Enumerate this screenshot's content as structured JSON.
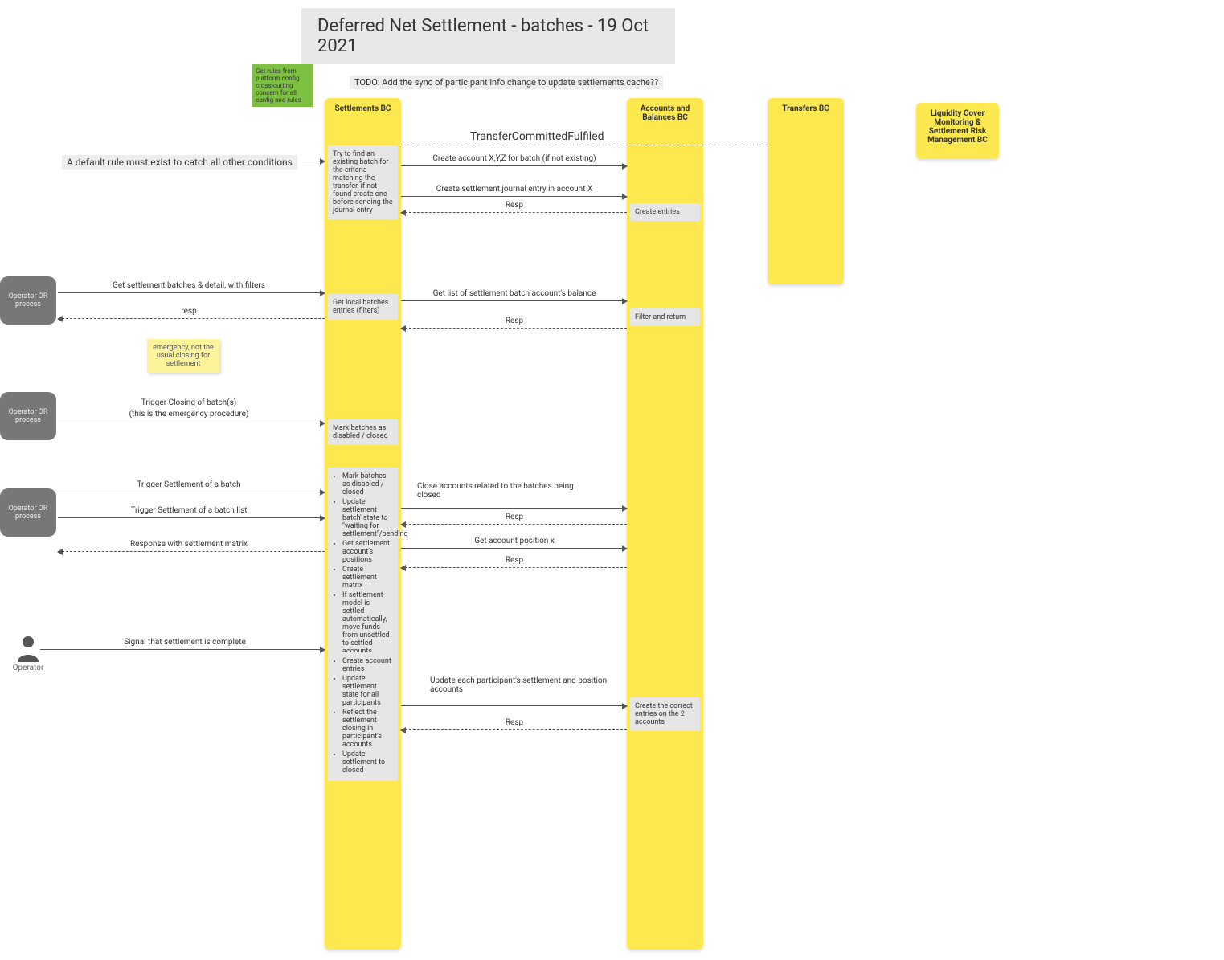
{
  "title": "Deferred Net Settlement - batches - 19 Oct 2021",
  "green_note": "Get rules from platform config cross-cutting concern for all config and rules",
  "todo_note": "TODO: Add the sync of participant info change to update settlements cache??",
  "default_rule": "A default rule must exist to catch all other conditions",
  "yellow_sticky": "emergency, not the usual closing for settlement",
  "event_label": "TransferCommittedFulfiled",
  "lanes": {
    "settlements": "Settlements BC",
    "accounts": "Accounts and Balances BC",
    "transfers": "Transfers BC",
    "liquidity": "Liquidity Cover Monitoring & Settlement Risk Management BC"
  },
  "actors": {
    "operator_process": "Operator OR process",
    "operator": "Operator"
  },
  "boxes": {
    "settlements_find_batch": "Try to find an existing batch for the criteria matching the transfer, if not found create one before sending the journal entry",
    "settlements_get_local": "Get local batches entries (filters)",
    "settlements_mark_disabled": "Mark batches as disabled / closed",
    "settlements_complex_1_items": [
      "Mark batches as disabled / closed",
      "Update settlement batch' state to \"waiting for settlement\"/pending",
      "Get settlement account's positions",
      "Create settlement matrix",
      "If settlement model is settled automatically, move funds from unsettled to settled accounts"
    ],
    "settlements_complex_2_items": [
      "Create account entries",
      "Update settlement state for all participants",
      "Reflect the settlement closing in participant's accounts",
      "Update settlement to closed"
    ],
    "accounts_create_entries": "Create entries",
    "accounts_filter_return": "Filter and return",
    "accounts_create_correct": "Create the correct entries on the 2 accounts"
  },
  "messages": {
    "m_get_batches": "Get settlement batches & detail, with filters",
    "m_resp1": "resp",
    "m_trigger_closing": "Trigger Closing of batch(s)",
    "m_trigger_closing_sub": "(this is the emergency procedure)",
    "m_trigger_settle": "Trigger Settlement of a batch",
    "m_trigger_settle_list": "Trigger Settlement of a batch list",
    "m_resp_matrix": "Response with settlement matrix",
    "m_signal_complete": "Signal that settlement is complete",
    "m_create_account": "Create account  X,Y,Z for batch (if not existing)",
    "m_create_journal": "Create settlement journal entry in account X",
    "m_resp2": "Resp",
    "m_get_balance": "Get list of settlement batch account's balance",
    "m_resp3": "Resp",
    "m_close_accounts": "Close accounts related to the batches being closed",
    "m_resp4": "Resp",
    "m_get_position": "Get account position x",
    "m_resp5": "Resp",
    "m_update_participants": "Update each participant's settlement and position accounts",
    "m_resp6": "Resp"
  }
}
